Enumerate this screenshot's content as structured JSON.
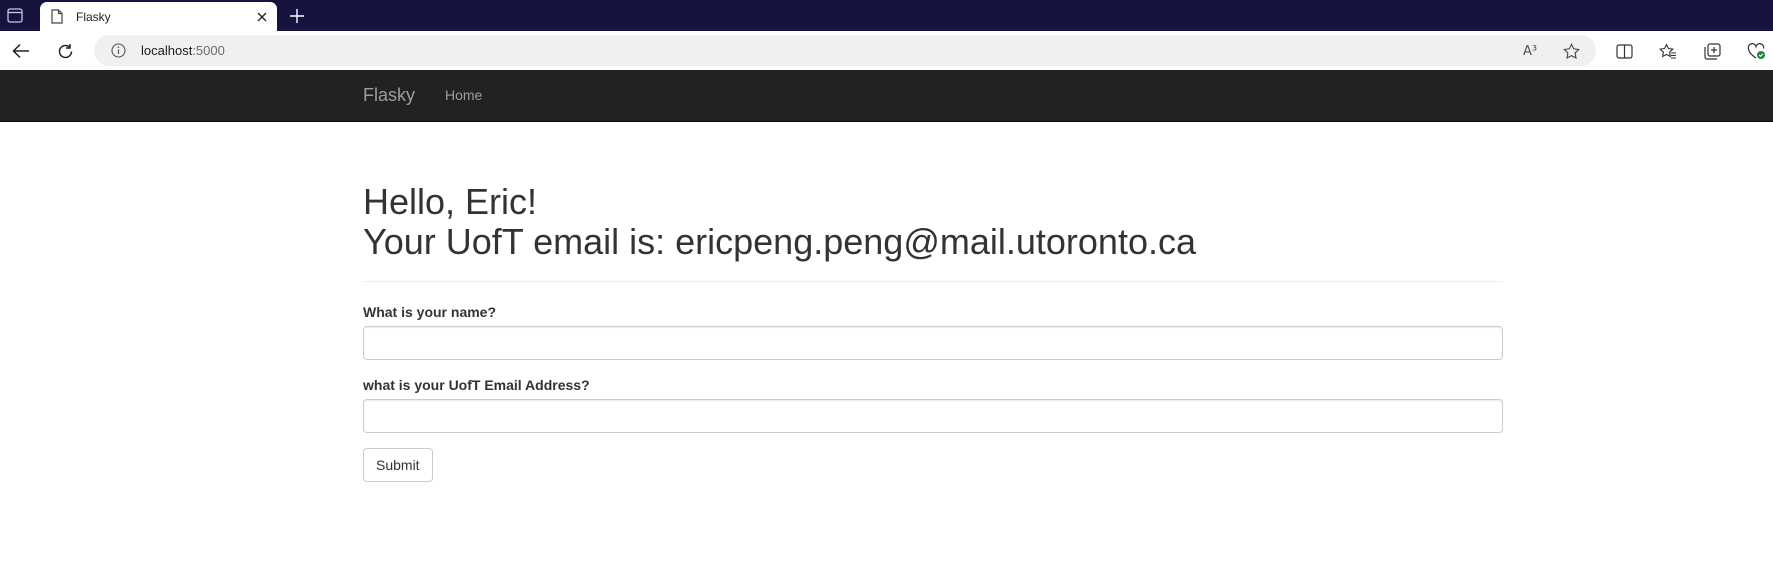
{
  "browser": {
    "tab_title": "Flasky",
    "url_host": "localhost",
    "url_port": ":5000",
    "read_aloud_label": "A³",
    "colors": {
      "tabstrip": "#16133f",
      "omnibox": "#eef0f2"
    }
  },
  "navbar": {
    "brand": "Flasky",
    "links": [
      {
        "label": "Home"
      }
    ],
    "colors": {
      "background": "#222222",
      "text": "#9d9d9d"
    }
  },
  "main": {
    "greeting": "Hello, Eric!",
    "email_line": "Your UofT email is: ericpeng.peng@mail.utoronto.ca",
    "form": {
      "name_label": "What is your name?",
      "name_value": "",
      "email_label": "what is your UofT Email Address?",
      "email_value": "",
      "submit_label": "Submit"
    }
  }
}
